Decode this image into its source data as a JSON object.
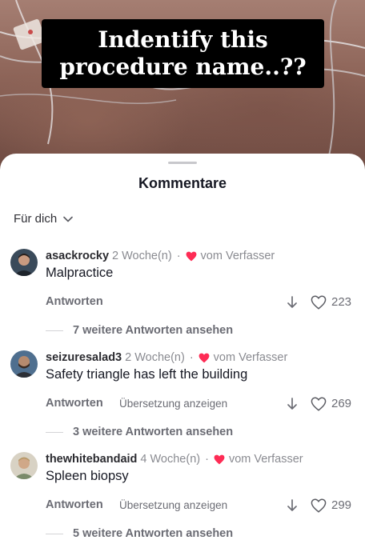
{
  "video": {
    "caption": "Indentify this\nprocedure name..??"
  },
  "sheet": {
    "title": "Kommentare",
    "filter_label": "Für dich"
  },
  "comments": [
    {
      "username": "asackrocky",
      "time": "2 Woche(n)",
      "separator": "·",
      "author_badge": "vom Verfasser",
      "text": "Malpractice",
      "reply_label": "Antworten",
      "translate_label": "",
      "likes": "223",
      "more_replies": "7 weitere Antworten ansehen",
      "avatar_colors": {
        "bg": "#3a4a5a",
        "face": "#c99a80"
      }
    },
    {
      "username": "seizuresalad3",
      "time": "2 Woche(n)",
      "separator": "·",
      "author_badge": "vom Verfasser",
      "text": "Safety triangle has left the building",
      "reply_label": "Antworten",
      "translate_label": "Übersetzung anzeigen",
      "likes": "269",
      "more_replies": "3 weitere Antworten ansehen",
      "avatar_colors": {
        "bg": "#4f6f8f",
        "face": "#b58a6e"
      }
    },
    {
      "username": "thewhitebandaid",
      "time": "4 Woche(n)",
      "separator": "·",
      "author_badge": "vom Verfasser",
      "text": "Spleen biopsy",
      "reply_label": "Antworten",
      "translate_label": "Übersetzung anzeigen",
      "likes": "299",
      "more_replies": "5 weitere Antworten ansehen",
      "avatar_colors": {
        "bg": "#d8d2c4",
        "face": "#d0a888"
      }
    }
  ],
  "icons": {
    "filter": "chevron-down-icon",
    "author": "heart-icon",
    "dislike": "arrow-down-icon",
    "like": "heart-outline-icon"
  },
  "colors": {
    "author_heart": "#fe2c55",
    "caption_bg": "#000000"
  }
}
